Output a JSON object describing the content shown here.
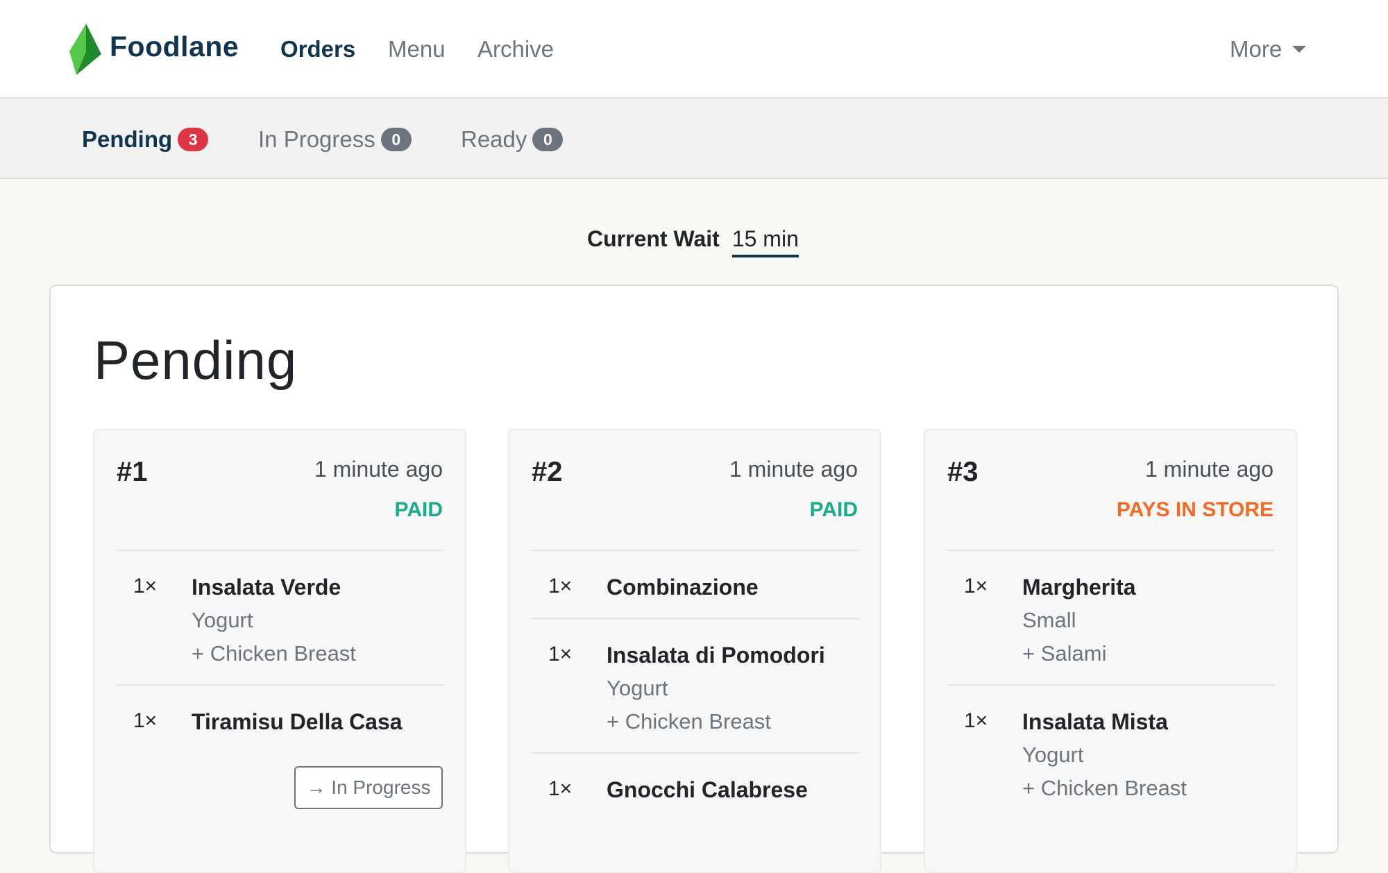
{
  "header": {
    "brand": "Foodlane",
    "nav": [
      "Orders",
      "Menu",
      "Archive"
    ],
    "more": "More",
    "colors": {
      "brand": "#0f3550",
      "logo_light": "#55c84a",
      "logo_dark": "#1f8a2c"
    }
  },
  "tabs": [
    {
      "label": "Pending",
      "count": "3"
    },
    {
      "label": "In Progress",
      "count": "0"
    },
    {
      "label": "Ready",
      "count": "0"
    }
  ],
  "wait": {
    "label": "Current Wait",
    "value": "15 min"
  },
  "section_title": "Pending",
  "orders": [
    {
      "number": "#1",
      "time": "1 minute ago",
      "status": "PAID",
      "items": [
        {
          "qty": "1×",
          "name": "Insalata Verde",
          "options": [
            "Yogurt",
            "+ Chicken Breast"
          ]
        },
        {
          "qty": "1×",
          "name": "Tiramisu Della Casa",
          "options": []
        }
      ],
      "action": "→ In Progress"
    },
    {
      "number": "#2",
      "time": "1 minute ago",
      "status": "PAID",
      "items": [
        {
          "qty": "1×",
          "name": "Combinazione",
          "options": []
        },
        {
          "qty": "1×",
          "name": "Insalata di Pomodori",
          "options": [
            "Yogurt",
            "+ Chicken Breast"
          ]
        },
        {
          "qty": "1×",
          "name": "Gnocchi Calabrese",
          "options": []
        }
      ]
    },
    {
      "number": "#3",
      "time": "1 minute ago",
      "status": "PAYS IN STORE",
      "items": [
        {
          "qty": "1×",
          "name": "Margherita",
          "options": [
            "Small",
            "+ Salami"
          ]
        },
        {
          "qty": "1×",
          "name": "Insalata Mista",
          "options": [
            "Yogurt",
            "+ Chicken Breast"
          ]
        }
      ]
    }
  ]
}
